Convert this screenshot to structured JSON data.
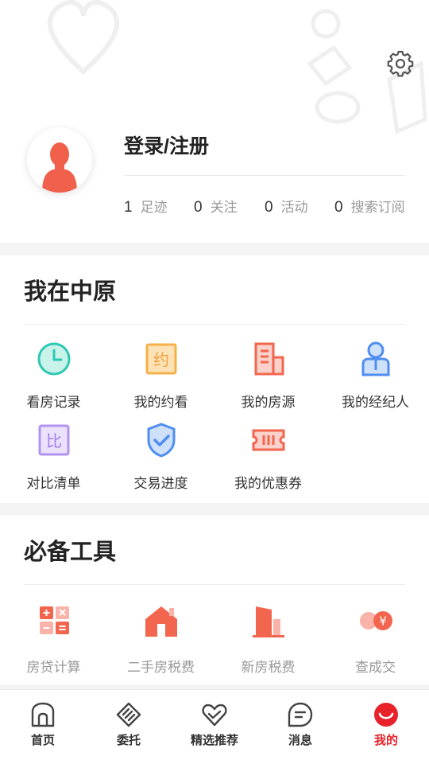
{
  "header": {
    "login_label": "登录/注册",
    "stats": [
      {
        "count": "1",
        "label": "足迹"
      },
      {
        "count": "0",
        "label": "关注"
      },
      {
        "count": "0",
        "label": "活动"
      },
      {
        "count": "0",
        "label": "搜索订阅"
      }
    ]
  },
  "section_my": {
    "title": "我在中原",
    "items": [
      {
        "label": "看房记录",
        "icon": "clock-icon"
      },
      {
        "label": "我的约看",
        "icon": "appointment-icon",
        "glyph": "约"
      },
      {
        "label": "我的房源",
        "icon": "building-icon"
      },
      {
        "label": "我的经纪人",
        "icon": "agent-icon"
      },
      {
        "label": "对比清单",
        "icon": "compare-icon",
        "glyph": "比"
      },
      {
        "label": "交易进度",
        "icon": "shield-check-icon"
      },
      {
        "label": "我的优惠券",
        "icon": "coupon-icon"
      }
    ]
  },
  "section_tools": {
    "title": "必备工具",
    "items": [
      {
        "label": "房贷计算",
        "icon": "calculator-icon"
      },
      {
        "label": "二手房税费",
        "icon": "house-icon"
      },
      {
        "label": "新房税费",
        "icon": "tower-icon"
      },
      {
        "label": "查成交",
        "icon": "deal-coin-icon",
        "glyph": "¥"
      }
    ]
  },
  "tabbar": {
    "items": [
      {
        "label": "首页",
        "icon": "home-icon",
        "active": false
      },
      {
        "label": "委托",
        "icon": "handshake-icon",
        "active": false
      },
      {
        "label": "精选推荐",
        "icon": "heart-recommend-icon",
        "active": false
      },
      {
        "label": "消息",
        "icon": "message-icon",
        "active": false
      },
      {
        "label": "我的",
        "icon": "profile-smile-icon",
        "active": true
      }
    ]
  },
  "colors": {
    "accent": "#e8222b",
    "orange_red": "#f2664f",
    "teal": "#2ec9b3",
    "gold": "#f5b04a",
    "blue": "#4f8ef0",
    "purple": "#b294f0",
    "text_gray": "#999999"
  }
}
